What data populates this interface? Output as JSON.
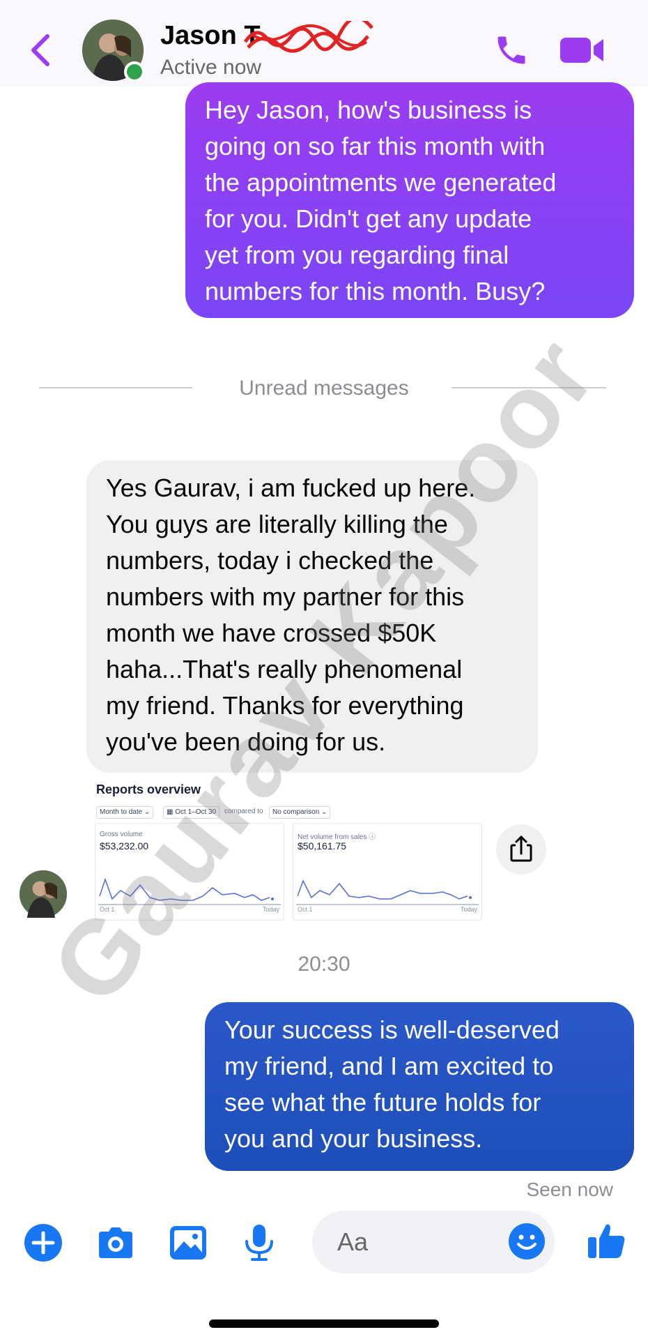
{
  "header": {
    "contact_name": "Jason T",
    "status": "Active now",
    "colors": {
      "accent": "#9b3cf2",
      "online": "#31a24c"
    },
    "icons": [
      "back-icon",
      "phone-icon",
      "video-icon"
    ]
  },
  "messages": {
    "outgoing_1": {
      "lines": [
        "Hey Jason, how's business is",
        "going on so far this month with",
        "the appointments we generated",
        "for you. Didn't get any update",
        "yet from you regarding final",
        "numbers for this month. Busy?"
      ]
    },
    "unread_label": "Unread messages",
    "incoming_1": {
      "lines": [
        "Yes Gaurav, i am fucked up here.",
        "You guys are literally killing the",
        "numbers, today i checked the",
        "numbers with my partner for this",
        "month we have crossed $50K",
        "haha...That's really phenomenal",
        "my friend. Thanks for everything",
        "you've been doing for us."
      ]
    },
    "attachment": {
      "title": "Reports overview",
      "period_filter": "Month to date",
      "date_range": "Oct 1–Oct 30",
      "compared_to": "compared to",
      "comparison": "No comparison",
      "gross": {
        "label": "Gross volume",
        "value": "$53,232.00",
        "start": "Oct 1",
        "end": "Today"
      },
      "net": {
        "label": "Net volume from sales",
        "value": "$50,161.75",
        "start": "Oct 1",
        "end": "Today"
      },
      "spark_color": "#5469d4"
    },
    "timestamp": "20:30",
    "outgoing_2": {
      "lines": [
        "Your success is well-deserved",
        "my friend, and I am excited to",
        "see what the future holds for",
        "you and your business."
      ]
    },
    "seen": "Seen now"
  },
  "composer": {
    "placeholder": "Aa",
    "icons": [
      "plus-icon",
      "camera-icon",
      "image-icon",
      "microphone-icon",
      "emoji-icon",
      "thumbs-up-icon"
    ],
    "accent": "#1877f2"
  },
  "watermark": "Gaurav Kapoor"
}
